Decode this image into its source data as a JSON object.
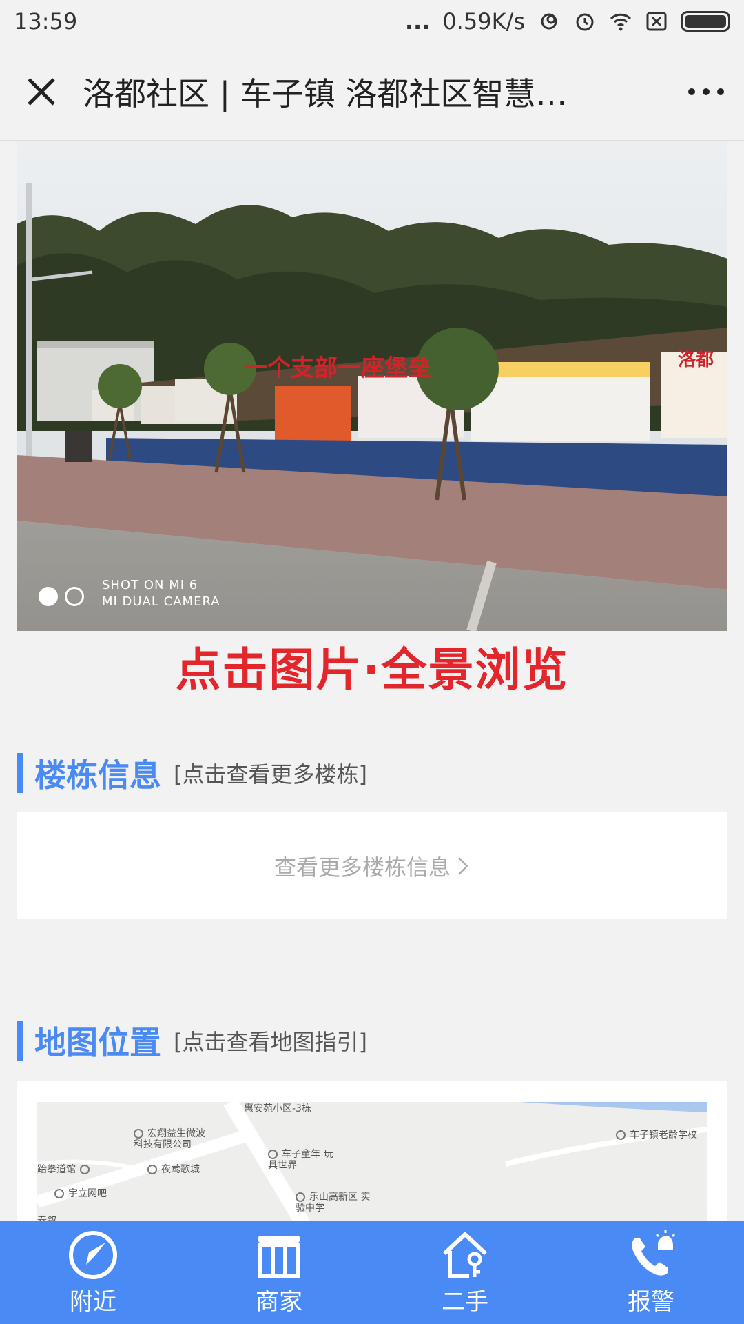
{
  "status_bar": {
    "time": "13:59",
    "speed": "0.59K/s",
    "dots": "..."
  },
  "navbar": {
    "title": "洛都社区 | 车子镇 洛都社区智慧…"
  },
  "banner": {
    "watermark_line1": "SHOT ON MI 6",
    "watermark_line2": "MI DUAL CAMERA",
    "slide_count": 2,
    "active_slide": 1,
    "signage": [
      "一个支部一座堡垒",
      "洛都"
    ]
  },
  "panorama_link": "点击图片·全景浏览",
  "buildings": {
    "title": "楼栋信息",
    "hint": "[点击查看更多楼栋]",
    "more": "查看更多楼栋信息"
  },
  "map_section": {
    "title": "地图位置",
    "hint": "[点击查看地图指引]",
    "labels": {
      "top": "惠安苑小区-3栋",
      "hongxiang": "宏翔益生微波 科技有限公司",
      "toys": "车子童年 玩具世界",
      "school_old": "车子镇老龄学校",
      "taekwondo": "跆拳道馆",
      "yeying": "夜莺歌城",
      "yuli": "宇立网吧",
      "middle_school": "乐山高新区 实验中学",
      "chunxu": "春叙"
    }
  },
  "tabs": [
    {
      "label": "附近",
      "icon": "compass-icon"
    },
    {
      "label": "商家",
      "icon": "store-icon"
    },
    {
      "label": "二手",
      "icon": "house-key-icon"
    },
    {
      "label": "报警",
      "icon": "alarm-phone-icon"
    }
  ],
  "colors": {
    "accent": "#4a8af4",
    "panorama_red": "#e3262c"
  }
}
